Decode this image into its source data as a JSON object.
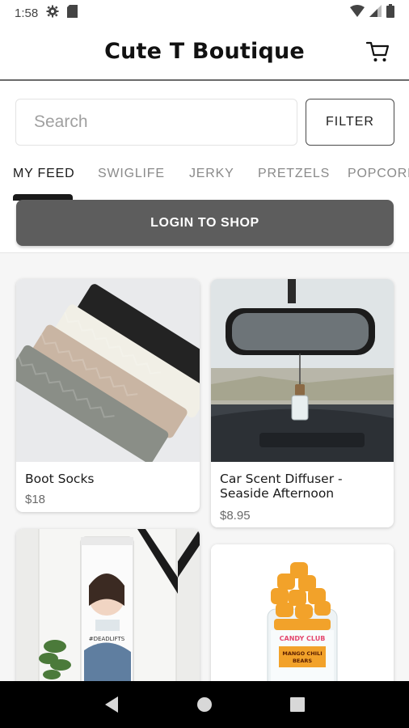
{
  "status": {
    "time": "1:58",
    "settings_icon": "gear-icon",
    "sd_icon": "sd-card-icon",
    "wifi_icon": "wifi-icon",
    "signal_icon": "signal-icon",
    "battery_icon": "battery-icon"
  },
  "app": {
    "title": "Cute T Boutique",
    "cart_icon": "cart-icon"
  },
  "search": {
    "placeholder": "Search",
    "value": "",
    "filter_label": "FILTER"
  },
  "tabs": [
    {
      "label": "MY FEED",
      "active": true
    },
    {
      "label": "SWIGLIFE",
      "active": false
    },
    {
      "label": "JERKY",
      "active": false
    },
    {
      "label": "PRETZELS",
      "active": false
    },
    {
      "label": "POPCORN",
      "active": false
    }
  ],
  "login": {
    "label": "LOGIN TO SHOP"
  },
  "products": [
    {
      "name": "Boot Socks",
      "price": "$18"
    },
    {
      "name": "Car Scent Diffuser - Seaside Afternoon",
      "name_line1": "Car Scent Diffuser -",
      "name_line2": "Seaside Afternoon",
      "price": "$8.95"
    },
    {
      "name": "",
      "price": ""
    },
    {
      "name": "",
      "price": ""
    }
  ],
  "product_images": {
    "tumbler_text": "#DEADLIFTS",
    "jar_brand": "CANDY CLUB",
    "jar_product_line1": "MANGO CHILI",
    "jar_product_line2": "BEARS"
  },
  "colors": {
    "login_bg": "#5d5d5d",
    "feed_bg": "#f6f6f6",
    "nav_bg": "#000000"
  }
}
